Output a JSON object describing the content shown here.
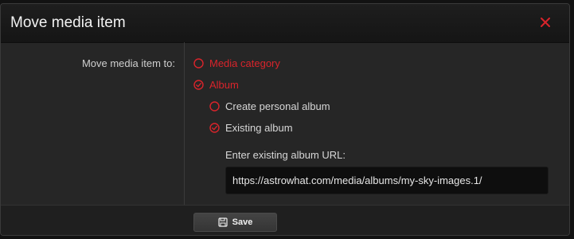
{
  "dialog": {
    "title": "Move media item",
    "close_icon": "close-icon"
  },
  "form": {
    "field_label": "Move media item to:",
    "options": [
      {
        "label": "Media category",
        "selected": false,
        "icon": "radio-unchecked-icon"
      },
      {
        "label": "Album",
        "selected": true,
        "icon": "radio-checked-icon"
      },
      {
        "label": "Create personal album",
        "selected": false,
        "icon": "radio-unchecked-icon"
      },
      {
        "label": "Existing album",
        "selected": true,
        "icon": "radio-checked-icon"
      }
    ],
    "url_label": "Enter existing album URL:",
    "url_value": "https://astrowhat.com/media/albums/my-sky-images.1/"
  },
  "footer": {
    "save_label": "Save",
    "save_icon": "save-icon"
  },
  "colors": {
    "accent": "#d8242b",
    "dialog_bg": "#262626",
    "input_bg": "#0e0e0e"
  }
}
